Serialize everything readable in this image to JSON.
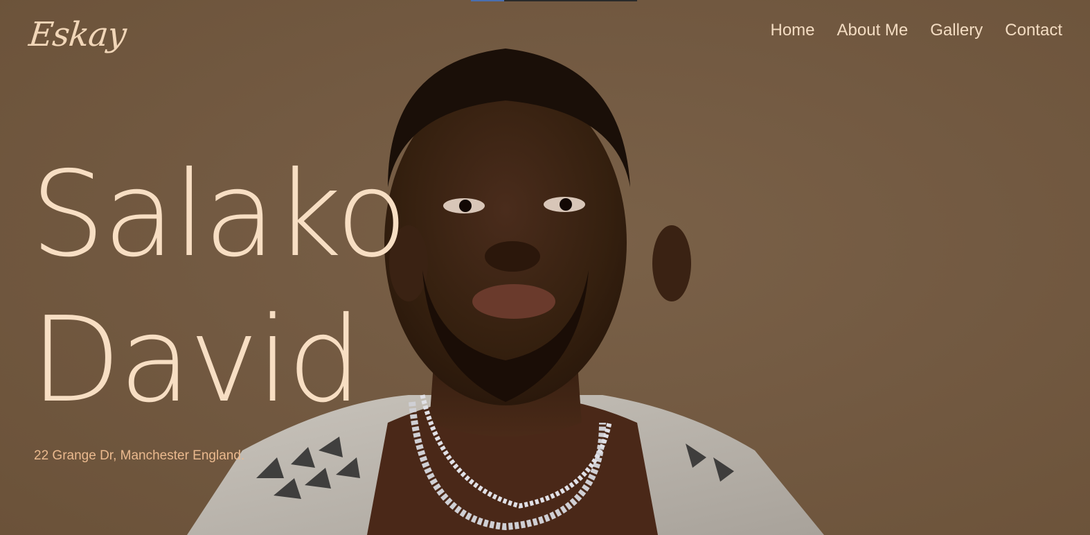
{
  "header": {
    "logo": "Eskay",
    "nav": [
      {
        "label": "Home"
      },
      {
        "label": "About Me"
      },
      {
        "label": "Gallery"
      },
      {
        "label": "Contact"
      }
    ]
  },
  "hero": {
    "first_name": "Salako",
    "last_name": "David",
    "address": "22 Grange Dr, Manchester England."
  },
  "scroll_progress": 0.2,
  "colors": {
    "background": "#735b43",
    "accent": "#f7dec3",
    "address": "#eab98e",
    "progress": "#4a6fb0"
  }
}
